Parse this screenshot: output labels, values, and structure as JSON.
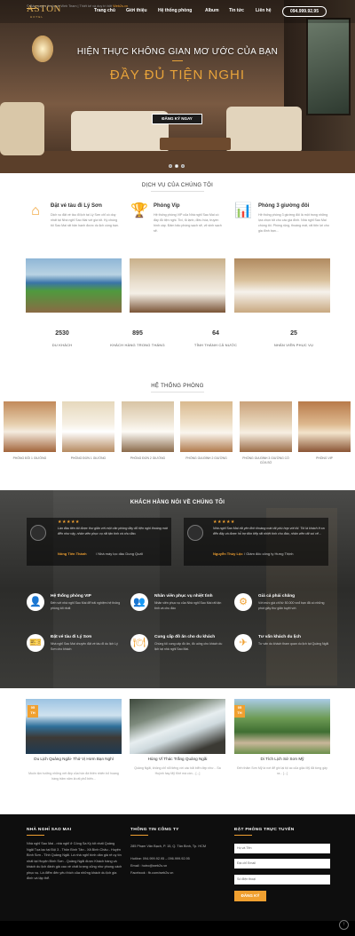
{
  "nav": {
    "logo": "ASTON",
    "logo_sub": "HOTEL",
    "items": [
      "Trang chủ",
      "Giới thiệu",
      "Hệ thống phòng",
      "Album",
      "Tin tức",
      "Liên hệ"
    ],
    "phone": "094.999.92.95"
  },
  "hero": {
    "title": "Hiện thực không gian mơ ước của bạn",
    "subtitle": "Đầy đủ tiện nghi",
    "button": "ĐĂNG KÝ NGAY"
  },
  "services": {
    "heading": "DỊCH VỤ CỦA CHÚNG TÔI",
    "items": [
      {
        "icon": "house-icon",
        "title": "Đặt vé tàu đi Lý Sơn",
        "desc": "Dịch vụ đặt vé tàu đi lịch tại Lý Sơn chỉ có duy nhất tại Nhà nghỉ Sao Mai với giá tốt. Ký chúng tôi Sao Mai rất hân hạnh được du lịch cùng bạn."
      },
      {
        "icon": "trophy-icon",
        "title": "Phòng Vip",
        "desc": "Hệ thống phòng VIP của Nhà nghỉ Sao Mai có đầy đủ tiện nghi. Tivi, tủ lạnh, điều hòa, truyền hình cáp. Đảm bảo phòng sạch sẽ, vệ sinh sạch sẽ."
      },
      {
        "icon": "chart-icon",
        "title": "Phòng 3 giường đôi",
        "desc": "Hệ thống phòng 3 giường đôi là một trong những lựa chọn tốt cho các gia đình. Nhà nghỉ Sao Mai chúng tôi. Phòng rộng, thoáng mát, rất tiện lợi cho gia đình bạn..."
      }
    ]
  },
  "stats": [
    {
      "num": "2530",
      "label": "DU KHÁCH"
    },
    {
      "num": "895",
      "label": "KHÁCH HÀNG TRONG THÁNG"
    },
    {
      "num": "64",
      "label": "TỈNH THÀNH CẢ NƯỚC"
    },
    {
      "num": "25",
      "label": "NHÂN VIÊN PHỤC VỤ"
    }
  ],
  "rooms": {
    "heading": "HỆ THỐNG PHÒNG",
    "items": [
      "PHÒNG ĐÔI 1 GIƯỜNG",
      "PHÒNG ĐƠN 1 GIƯỜNG",
      "PHÒNG ĐƠN 2 GIƯỜNG",
      "PHÒNG GIA ĐÌNH 2 GIƯỜNG",
      "PHÒNG GIA ĐÌNH 3 GIƯỜNG CÓ CỬA SỔ",
      "PHÒNG VIP"
    ]
  },
  "testimonials": {
    "heading": "KHÁCH HÀNG NÓI VỀ CHÚNG TÔI",
    "items": [
      {
        "stars": "★★★★★",
        "quote": "Lần đầu tiên tôi được thư giãn với một căn phòng đầy đủ tiện nghi thoáng mát đến như vậy, nhân viên phục vụ rất tận tình và chu đáo.",
        "name": "Nông Tiến Thành",
        "role": " / Nhà máy lọc dầu Dung Quất"
      },
      {
        "stars": "★★★★★",
        "quote": "Nhà nghỉ Sao Mai rất yên tĩnh thoáng mát rất phù hợp với tôi. Tôi là khách ở xa đến đây và được hỗ trợ đón tiếp rất nhiệt tình chu đáo, nhân viên rất vui vẻ...",
        "name": "Nguyễn Thúy Lộc",
        "role": " / Giám đốc công ty Hưng Thịnh"
      }
    ]
  },
  "features": [
    {
      "icon": "user-icon",
      "title": "Hệ thống phòng VIP",
      "desc": "Đến với nhà nghỉ Sao Mai để trải nghiệm hệ thống phòng tốt nhất"
    },
    {
      "icon": "team-icon",
      "title": "Nhân viên phục vụ nhiệt tình",
      "desc": "Nhân viên phục vụ của Nhà nghỉ Sao Mai rất tận tình và chu đáo"
    },
    {
      "icon": "network-icon",
      "title": "Giá cả phải chăng",
      "desc": "Với mức giá chỉ từ 50.000 vnđ bạn đã có những phút giây thư giãn tuyệt vời."
    },
    {
      "icon": "ticket-icon",
      "title": "Đặt vé tàu đi Lý Sơn",
      "desc": "Nhà nghỉ Sao Mai chuyên đặt vé tàu đi du lịch Lý Sơn cho khách"
    },
    {
      "icon": "food-icon",
      "title": "Cung cấp đồ ăn cho du khách",
      "desc": "Chúng tôi cung cấp đồ ăn, đồ uống cho khách du lịch tại nhà nghỉ Sao Mai."
    },
    {
      "icon": "guide-icon",
      "title": "Tư vấn khách du lịch",
      "desc": "Tư vấn du khách tham quan du lịch tại Quảng Ngãi"
    }
  ],
  "news": [
    {
      "day": "05",
      "mon": "TH",
      "title": "Du Lịch Quảng Ngãi- Thử Vị Hơm Bạn Nghỉ",
      "desc": "Muốn tận hưởng những nét đẹp của hòn đá thiên nhiên bỏ hoang hàng trăm năm là rất phổ biến..."
    },
    {
      "day": "05",
      "mon": "TH",
      "title": "Hùng Vĩ Thác Trắng Quảng Ngãi",
      "desc": "Quảng Ngãi, không chỉ nổi tiếng với các bãi biển đẹp như... Sa Huỳnh hay Mỹ Khê mà còn... [...]"
    },
    {
      "day": "05",
      "mon": "TH",
      "title": "Di Tích Lịch Sử Sơn Mỹ",
      "desc": "Đến thăm Sơn Mỹ là nơi để ghi lại tội ác của giặc Mỹ đã từng gây ra... [...]"
    }
  ],
  "footer": {
    "col1_title": "NHÀ NGHỈ SAO MAI",
    "col1_text": "Nhà nghỉ Sao Mai - nhà nghỉ ở Công Sa Kỳ tốt nhất Quảng Ngãi Tọa lạc tại Đội 3 - Thôn Bình Tân - Xã Bình Châu - Huyện Bình Sơn - Tỉnh Quảng Ngãi. Là nhà nghỉ bình dân giá rẻ uy tín nhất tại Huyện Bình Sơn - Quảng Ngãi được Khách hàng và khách du lịch đánh giá cao về chất lượng cũng như phong cách phục vụ. Là điểm đến yêu thích của những khách du lịch gia đình và tập thể.",
    "col2_title": "THÔNG TIN CÔNG TY",
    "col2_lines": [
      "285 Phạm Văn Bạch, P. 15, Q. Tân Bình, Tp. HCM",
      "Hotline: 094.999.92.95 – 096.999.92.95",
      "Email : hotro@web2s.vn",
      "Facebook : fb.com/web2s.vn"
    ],
    "col3_title": "ĐẶT PHÒNG TRỰC TUYẾN",
    "inputs": [
      "Họ và Tên",
      "Địa chỉ Email",
      "Số điện thoại"
    ],
    "button": "ĐĂNG KÝ",
    "copyright": "© Bản quyền thuộc về Web Team | Thiết kế và duy trì bởi ",
    "copyright_link": "Web2s.vn"
  }
}
